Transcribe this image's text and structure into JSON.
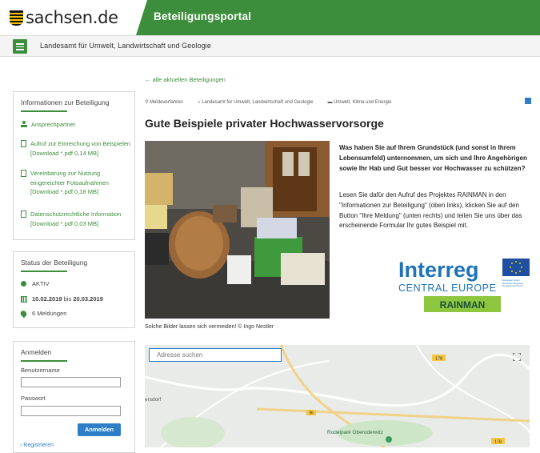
{
  "header": {
    "logo_text": "sachsen.de",
    "portal_title": "Beteiligungsportal"
  },
  "nav": {
    "title": "Landesamt für Umwelt, Landwirtschaft und Geologie"
  },
  "info_box": {
    "title": "Informationen zur Beteiligung",
    "links": [
      {
        "label": "Ansprechpartner"
      },
      {
        "label": "Aufruf zur Einreichung von Beispielen [Download *.pdf 0,14 MB]"
      },
      {
        "label": "Vereinbarung zur Nutzung eingereichter Fotoaufnahmen [Download *.pdf 0,18 MB]"
      },
      {
        "label": "Datenschutzrechtliche Information [Download *.pdf 0,03 MB]"
      }
    ]
  },
  "status_box": {
    "title": "Status der Beteiligung",
    "state": "AKTIV",
    "date_from": "10.02.2019",
    "date_sep": "bis",
    "date_to": "20.03.2019",
    "count": "6 Meldungen"
  },
  "login_box": {
    "title": "Anmelden",
    "username_label": "Benutzername",
    "password_label": "Passwort",
    "submit": "Anmelden",
    "register": "Registrieren"
  },
  "main": {
    "back_link": "alle aktuellen Beteiligungen",
    "breadcrumbs": [
      "Meldeverfahren",
      "Landesamt für Umwelt, Landwirtschaft und Geologie",
      "Umwelt, Klima und Energie"
    ],
    "title": "Gute Beispiele privater Hochwasservorsorge",
    "lead": "Was haben Sie auf Ihrem Grundstück (und sonst in Ihrem Lebensumfeld) unternommen, um sich und Ihre Angehörigen sowie Ihr Hab und Gut besser vor Hochwasser zu schützen?",
    "body": "Lesen Sie dafür den Aufruf des Projektes RAINMAN in den \"Informationen zur Beteiligung\" (oben links), klicken Sie auf den Button \"Ihre Meldung\" (unten rechts) und teilen Sie uns über das erscheinende Formular Ihr gutes Beispiel mit.",
    "caption": "Solche Bilder lassen sich vermeiden! © Ingo Nestler"
  },
  "logo": {
    "interreg": "Interreg",
    "central": "CENTRAL EUROPE",
    "rainman": "RAINMAN",
    "eu_text": "European Union European Regional Development Fund"
  },
  "map": {
    "search_placeholder": "Adresse suchen",
    "place1": "Rodelpark Oberoderwitz",
    "place2": "ersdorf",
    "road1": "178",
    "road2": "178",
    "road3": "96"
  },
  "colors": {
    "brand_green": "#3c8e3c",
    "link_blue": "#2d7ec6",
    "rainman_green": "#8dc63f",
    "interreg_blue": "#1e73b8"
  }
}
